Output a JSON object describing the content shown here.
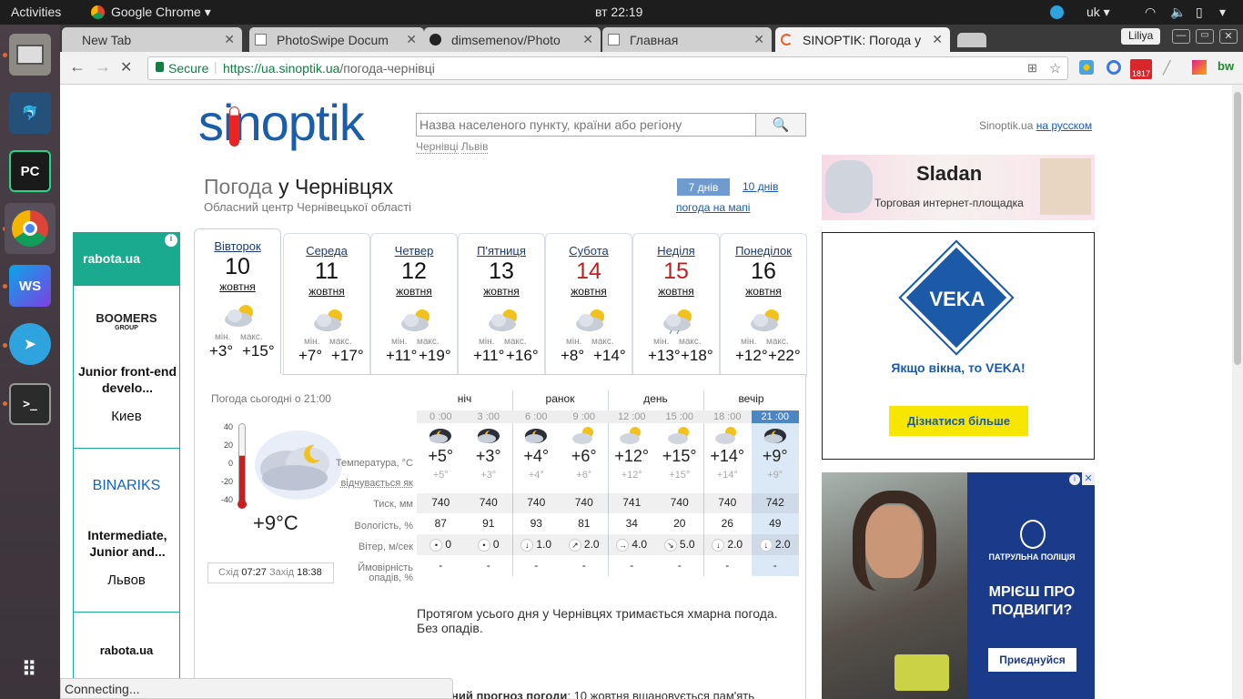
{
  "desktop": {
    "activities": "Activities",
    "app_name": "Google Chrome",
    "clock": "вт 22:19",
    "lang": "uk"
  },
  "browser": {
    "profile": "Liliya",
    "tabs": [
      {
        "label": "New Tab"
      },
      {
        "label": "PhotoSwipe Docum"
      },
      {
        "label": "dimsemenov/Photo"
      },
      {
        "label": "Главная"
      },
      {
        "label": "SINOPTIK: Погода у"
      }
    ],
    "secure_label": "Secure",
    "url_host": "https://ua.sinoptik.ua",
    "url_path": "/погода-чернівці",
    "ext_badge": "1817",
    "status": "Connecting..."
  },
  "site": {
    "logo": "sinoptik",
    "search_placeholder": "Назва населеного пункту, країни або регіону",
    "recent": [
      "Чернівці",
      "Львів"
    ],
    "lang_prefix": "Sinoptik.ua",
    "lang_link": "на русском",
    "title_grey": "Погода",
    "title_dark": "у Чернівцях",
    "subtitle": "Обласний центр Чернівецької області",
    "btn_7": "7 днів",
    "btn_10": "10 днів",
    "map_link": "погода на мапі"
  },
  "days": [
    {
      "name": "Вівторок",
      "date": "10",
      "month": "жовтня",
      "min_lbl": "мін.",
      "max_lbl": "макс.",
      "min": "+3°",
      "max": "+15°",
      "icon": "cloud-sun-icon"
    },
    {
      "name": "Середа",
      "date": "11",
      "month": "жовтня",
      "min_lbl": "мін.",
      "max_lbl": "макс.",
      "min": "+7°",
      "max": "+17°",
      "icon": "cloud-sun-icon"
    },
    {
      "name": "Четвер",
      "date": "12",
      "month": "жовтня",
      "min_lbl": "мін.",
      "max_lbl": "макс.",
      "min": "+11°",
      "max": "+19°",
      "icon": "cloud-sun-icon"
    },
    {
      "name": "П'ятниця",
      "date": "13",
      "month": "жовтня",
      "min_lbl": "мін.",
      "max_lbl": "макс.",
      "min": "+11°",
      "max": "+16°",
      "icon": "cloud-sun-icon"
    },
    {
      "name": "Субота",
      "date": "14",
      "month": "жовтня",
      "min_lbl": "мін.",
      "max_lbl": "макс.",
      "min": "+8°",
      "max": "+14°",
      "icon": "cloud-sun-icon"
    },
    {
      "name": "Неділя",
      "date": "15",
      "month": "жовтня",
      "min_lbl": "мін.",
      "max_lbl": "макс.",
      "min": "+13°",
      "max": "+18°",
      "icon": "cloud-rain-icon"
    },
    {
      "name": "Понеділок",
      "date": "16",
      "month": "жовтня",
      "min_lbl": "мін.",
      "max_lbl": "макс.",
      "min": "+12°",
      "max": "+22°",
      "icon": "sun-cloud-icon"
    }
  ],
  "now": {
    "caption": "Погода сьогодні о 21:00",
    "temp": "+9°C",
    "scale": [
      "40",
      "20",
      "0",
      "-20",
      "-40"
    ],
    "sunrise_lbl": "Схід",
    "sunrise": "07:27",
    "sunset_lbl": "Захід",
    "sunset": "18:38"
  },
  "periods": [
    "ніч",
    "ранок",
    "день",
    "вечір"
  ],
  "hours": [
    "0 :00",
    "3 :00",
    "6 :00",
    "9 :00",
    "12 :00",
    "15 :00",
    "18 :00",
    "21 :00"
  ],
  "row_labels": {
    "temp": "Температура, °C",
    "feels": "відчувається як",
    "pressure": "Тиск, мм",
    "humidity": "Вологість, %",
    "wind": "Вітер, м/сек",
    "precip1": "Ймовірність",
    "precip2": "опадів, %"
  },
  "temps": [
    "+5°",
    "+3°",
    "+4°",
    "+6°",
    "+12°",
    "+15°",
    "+14°",
    "+9°"
  ],
  "feels": [
    "+5°",
    "+3°",
    "+4°",
    "+6°",
    "+12°",
    "+15°",
    "+14°",
    "+9°"
  ],
  "pressure": [
    "740",
    "740",
    "740",
    "740",
    "741",
    "740",
    "740",
    "742"
  ],
  "humidity": [
    "87",
    "91",
    "93",
    "81",
    "34",
    "20",
    "26",
    "49"
  ],
  "wind": [
    "0",
    "0",
    "1.0",
    "2.0",
    "4.0",
    "5.0",
    "2.0",
    "2.0"
  ],
  "wind_dir": [
    "•",
    "•",
    "↓",
    "↗",
    "→",
    "↘",
    "↓",
    "↓"
  ],
  "precip": [
    "-",
    "-",
    "-",
    "-",
    "-",
    "-",
    "-",
    "-"
  ],
  "description": "Протягом усього дня у Чернівцях тримається хмарна погода. Без опадів.",
  "footer_text_a": "ний прогноз погоди",
  "footer_text_b": ": 10 жовтня вшановується пам'ять",
  "ads": {
    "rabota_logo": "rabota.ua",
    "job1_company": "BOOMERS",
    "job1_group": "GROUP",
    "job1_title": "Junior front-end develo...",
    "job1_city": "Киев",
    "job2_company": "BINARIKS",
    "job2_title": "Intermediate, Junior and...",
    "job2_city": "Львов",
    "job3_logo": "rabota.ua",
    "sladan_logo": "Sladan",
    "sladan_tag": "Торговая интернет-площадка",
    "veka_logo": "VEKA",
    "veka_tag": "Якщо вікна, то VEKA!",
    "veka_btn": "Дізнатися більше",
    "police_org": "ПАТРУЛЬНА ПОЛІЦІЯ",
    "police_title": "МРІЄШ ПРО ПОДВИГИ?",
    "police_btn": "Приєднуйся"
  }
}
